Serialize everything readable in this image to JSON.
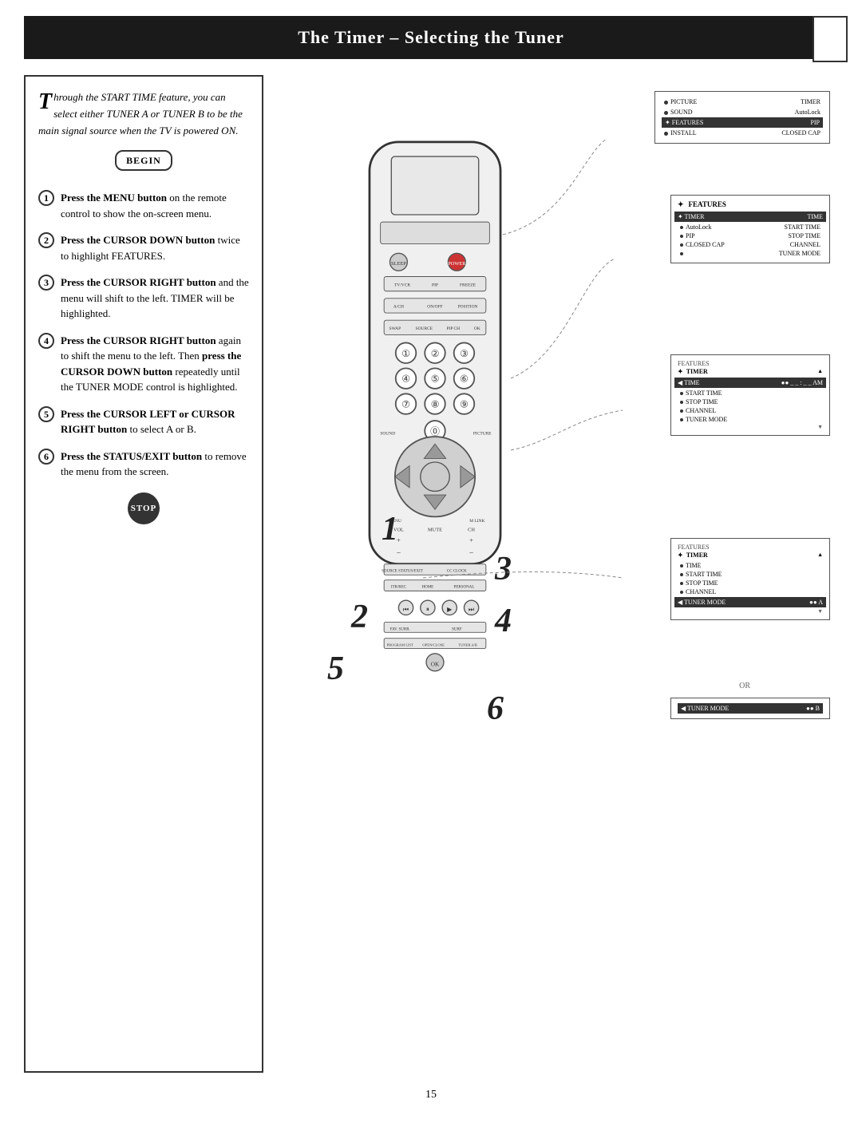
{
  "header": {
    "title": "The Timer – Selecting the Tuner"
  },
  "intro": {
    "text": "hrough the START TIME feature, you can select either TUNER A or TUNER B to be the main signal source when the TV is powered ON.",
    "drop_cap": "T"
  },
  "begin_label": "BEGIN",
  "stop_label": "STOP",
  "steps": [
    {
      "number": "1",
      "bold": "Press the MENU button",
      "text": " on the remote control to show the on-screen menu."
    },
    {
      "number": "2",
      "bold": "Press the CURSOR DOWN button",
      "text": " twice to highlight FEATURES."
    },
    {
      "number": "3",
      "bold": "Press the CURSOR RIGHT button",
      "text": " and the menu will shift to the left. TIMER will be highlighted."
    },
    {
      "number": "4",
      "bold": "Press the CURSOR RIGHT button",
      "text": " again to shift the menu to the left. Then press the CURSOR DOWN button repeatedly until the TUNER MODE control is highlighted."
    },
    {
      "number": "5",
      "bold": "Press the CURSOR LEFT or CURSOR RIGHT button",
      "text": " to select A or B."
    },
    {
      "number": "6",
      "bold": "Press the STATUS/EXIT button",
      "text": " to remove the menu from the screen."
    }
  ],
  "screens": [
    {
      "id": "screen1",
      "label": "Main menu with FEATURES highlighted",
      "items": [
        {
          "text": "PICTURE",
          "right": "TIMER",
          "highlighted": false
        },
        {
          "text": "SOUND",
          "right": "AutoLock",
          "highlighted": false
        },
        {
          "text": "FEATURES",
          "right": "PIP",
          "highlighted": true
        },
        {
          "text": "INSTALL",
          "right": "CLOSED CAP",
          "highlighted": false
        }
      ]
    },
    {
      "id": "screen2",
      "label": "FEATURES menu with TIMER highlighted",
      "title": "FEATURES",
      "items": [
        {
          "text": "TIMER",
          "right": "TIME",
          "highlighted": true
        },
        {
          "text": "AutoLock",
          "right": "",
          "highlighted": false
        },
        {
          "text": "PIP",
          "right": "START TIME",
          "highlighted": false
        },
        {
          "text": "CLOSED CAP",
          "right": "STOP TIME",
          "highlighted": false
        },
        {
          "text": "",
          "right": "CHANNEL",
          "highlighted": false
        },
        {
          "text": "",
          "right": "TUNER MODE",
          "highlighted": false
        }
      ]
    },
    {
      "id": "screen3",
      "label": "TIMER submenu",
      "title_top": "FEATURES",
      "title_sub": "TIMER",
      "items": [
        {
          "text": "TIME",
          "right": "_ _ : _ _ AM",
          "highlighted": true
        },
        {
          "text": "START TIME",
          "right": "",
          "highlighted": false
        },
        {
          "text": "STOP TIME",
          "right": "",
          "highlighted": false
        },
        {
          "text": "CHANNEL",
          "right": "",
          "highlighted": false
        },
        {
          "text": "TUNER MODE",
          "right": "",
          "highlighted": false
        }
      ]
    },
    {
      "id": "screen4",
      "label": "TUNER MODE A selected",
      "title_top": "FEATURES",
      "title_sub": "TIMER",
      "items": [
        {
          "text": "TIME",
          "right": "",
          "highlighted": false
        },
        {
          "text": "START TIME",
          "right": "",
          "highlighted": false
        },
        {
          "text": "STOP TIME",
          "right": "",
          "highlighted": false
        },
        {
          "text": "CHANNEL",
          "right": "",
          "highlighted": false
        },
        {
          "text": "TUNER MODE",
          "right": "A",
          "highlighted": true
        }
      ]
    },
    {
      "id": "screen5",
      "label": "TUNER MODE B option",
      "text": "TUNER MODE",
      "value": "B"
    }
  ],
  "page_number": "15"
}
